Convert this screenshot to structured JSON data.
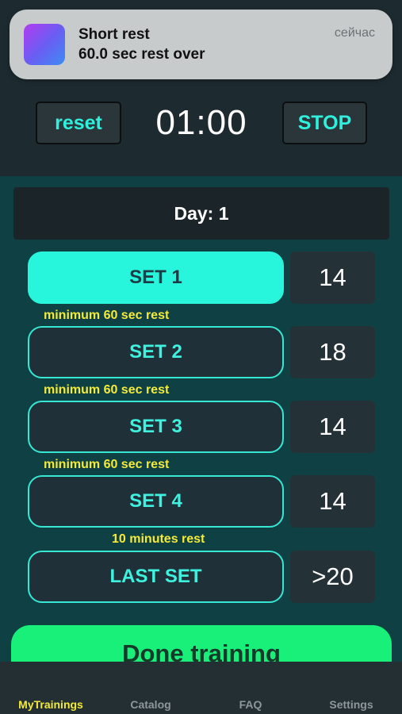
{
  "notification": {
    "title": "Short rest",
    "body": "60.0 sec rest over",
    "time": "сейчас",
    "icon": "app-gradient-icon"
  },
  "timer_bar": {
    "reset_label": "reset",
    "time": "01:00",
    "stop_label": "STOP"
  },
  "day": {
    "label": "Day: 1"
  },
  "sets": [
    {
      "label": "SET 1",
      "count": "14",
      "active": true,
      "rest_note": "minimum 60 sec rest"
    },
    {
      "label": "SET 2",
      "count": "18",
      "active": false,
      "rest_note": "minimum 60 sec rest"
    },
    {
      "label": "SET 3",
      "count": "14",
      "active": false,
      "rest_note": "minimum 60 sec rest"
    },
    {
      "label": "SET 4",
      "count": "14",
      "active": false,
      "rest_note": "10 minutes rest"
    },
    {
      "label": "LAST SET",
      "count": ">20",
      "active": false,
      "rest_note": ""
    }
  ],
  "done_button": {
    "label": "Done training"
  },
  "tabs": [
    {
      "label": "MyTrainings",
      "active": true
    },
    {
      "label": "Catalog",
      "active": false
    },
    {
      "label": "FAQ",
      "active": false
    },
    {
      "label": "Settings",
      "active": false
    }
  ],
  "colors": {
    "accent_cyan": "#27f5dc",
    "rest_note_yellow": "#f3ea3a",
    "done_green": "#18f07a",
    "main_teal": "#0f4144"
  }
}
